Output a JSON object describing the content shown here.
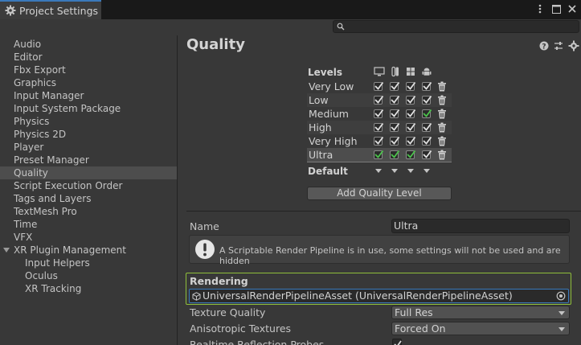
{
  "window": {
    "tab_title": "Project Settings"
  },
  "search": {
    "placeholder": ""
  },
  "sidebar": {
    "items": [
      {
        "label": "Audio"
      },
      {
        "label": "Editor"
      },
      {
        "label": "Fbx Export"
      },
      {
        "label": "Graphics"
      },
      {
        "label": "Input Manager"
      },
      {
        "label": "Input System Package"
      },
      {
        "label": "Physics"
      },
      {
        "label": "Physics 2D"
      },
      {
        "label": "Player"
      },
      {
        "label": "Preset Manager"
      },
      {
        "label": "Quality",
        "selected": true
      },
      {
        "label": "Script Execution Order"
      },
      {
        "label": "Tags and Layers"
      },
      {
        "label": "TextMesh Pro"
      },
      {
        "label": "Time"
      },
      {
        "label": "VFX"
      },
      {
        "label": "XR Plugin Management",
        "expanded": true
      },
      {
        "label": "Input Helpers",
        "child": true
      },
      {
        "label": "Oculus",
        "child": true
      },
      {
        "label": "XR Tracking",
        "child": true
      }
    ]
  },
  "main": {
    "title": "Quality",
    "levels_header": "Levels",
    "platform_icons": [
      "desktop-icon",
      "switch-icon",
      "windows-icon",
      "android-icon"
    ],
    "levels": [
      {
        "name": "Very Low",
        "checks": [
          true,
          true,
          true,
          true
        ],
        "default_for": []
      },
      {
        "name": "Low",
        "checks": [
          true,
          true,
          true,
          true
        ],
        "default_for": []
      },
      {
        "name": "Medium",
        "checks": [
          true,
          true,
          true,
          true
        ],
        "default_for": [
          3
        ]
      },
      {
        "name": "High",
        "checks": [
          true,
          true,
          true,
          true
        ],
        "default_for": []
      },
      {
        "name": "Very High",
        "checks": [
          true,
          true,
          true,
          true
        ],
        "default_for": []
      },
      {
        "name": "Ultra",
        "checks": [
          true,
          true,
          true,
          true
        ],
        "default_for": [
          0,
          1,
          2
        ],
        "selected": true
      }
    ],
    "default_label": "Default",
    "add_level_label": "Add Quality Level",
    "name_label": "Name",
    "name_value": "Ultra",
    "info_message": "A Scriptable Render Pipeline is in use, some settings will not be used and are hidden",
    "rendering_title": "Rendering",
    "render_pipeline_value": "UniversalRenderPipelineAsset (UniversalRenderPipelineAsset)",
    "texture_quality_label": "Texture Quality",
    "texture_quality_value": "Full Res",
    "anisotropic_label": "Anisotropic Textures",
    "anisotropic_value": "Forced On",
    "realtime_reflection_label": "Realtime Reflection Probes",
    "realtime_reflection_checked": true
  },
  "colors": {
    "accent": "#3a79bb",
    "highlight_border": "#8fbf3a",
    "default_check": "#4cc24c"
  }
}
